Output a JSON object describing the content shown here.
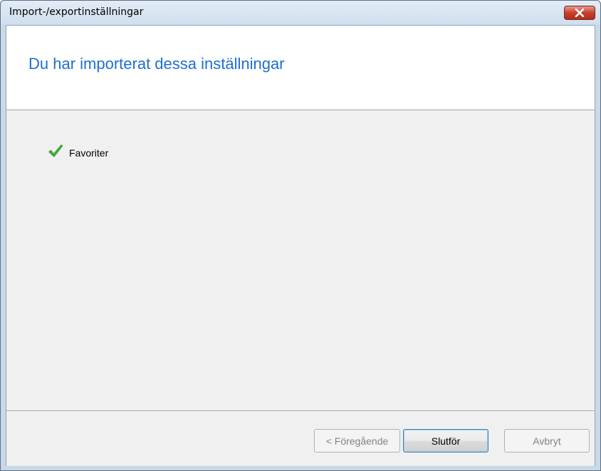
{
  "window": {
    "title": "Import-/exportinställningar",
    "close_icon": "close-icon"
  },
  "header": {
    "heading": "Du har importerat dessa inställningar",
    "heading_color": "#1f6fd0"
  },
  "items": [
    {
      "label": "Favoriter",
      "icon": "checkmark-icon",
      "icon_color": "#3fae3a"
    }
  ],
  "buttons": {
    "previous_label": "< Föregående",
    "finish_label": "Slutför",
    "cancel_label": "Avbryt"
  }
}
